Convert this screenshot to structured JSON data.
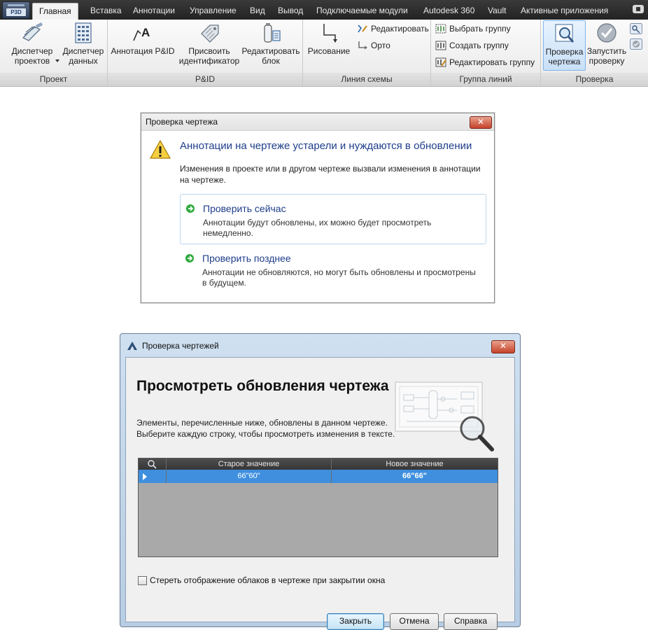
{
  "ribbon": {
    "app_badge": "P3D",
    "tabs": [
      {
        "label": "Главная",
        "active": true
      },
      {
        "label": "Вставка"
      },
      {
        "label": "Аннотации"
      },
      {
        "label": "Управление"
      },
      {
        "label": "Вид"
      },
      {
        "label": "Вывод"
      },
      {
        "label": "Подключаемые модули"
      },
      {
        "label": "Autodesk 360"
      },
      {
        "label": "Vault"
      },
      {
        "label": "Активные приложения"
      }
    ],
    "groups": {
      "project": {
        "label": "Проект",
        "project_manager": "Диспетчер\nпроектов",
        "data_manager": "Диспетчер\nданных"
      },
      "pid": {
        "label": "P&ID",
        "annotation": "Аннотация P&ID",
        "assign_tag": "Присвоить\nидентификатор",
        "edit_block": "Редактировать\nблок"
      },
      "schematic_line": {
        "label": "Линия схемы",
        "draw": "Рисование",
        "edit": "Редактировать",
        "ortho": "Орто"
      },
      "line_group": {
        "label": "Группа линий",
        "select": "Выбрать группу",
        "create": "Создать группу",
        "edit": "Редактировать группу"
      },
      "validate": {
        "label": "Проверка",
        "check_drawing": "Проверка\nчертежа",
        "run_check": "Запустить\nпроверку"
      }
    }
  },
  "dialog1": {
    "title": "Проверка чертежа",
    "close": "✕",
    "heading": "Аннотации на чертеже устарели и нуждаются в обновлении",
    "description": "Изменения в проекте или в другом чертеже вызвали изменения в аннотации на чертеже.",
    "options": [
      {
        "title": "Проверить сейчас",
        "description": "Аннотации будут обновлены, их можно будет просмотреть немедленно."
      },
      {
        "title": "Проверить позднее",
        "description": "Аннотации не обновляются, но могут быть обновлены и просмотрены в будущем."
      }
    ]
  },
  "dialog2": {
    "title": "Проверка чертежей",
    "close": "✕",
    "heading": "Просмотреть обновления чертежа",
    "description_line1": "Элементы, перечисленные ниже, обновлены в данном чертеже.",
    "description_line2": "Выберите каждую строку, чтобы просмотреть изменения в тексте.",
    "table": {
      "columns": [
        "",
        "Старое значение",
        "Новое значение"
      ],
      "rows": [
        {
          "old_value": "66\"60\"",
          "new_value": "66\"66\""
        }
      ]
    },
    "checkbox_label": "Стереть отображение облаков в чертеже при закрытии окна",
    "checkbox_checked": false,
    "buttons": {
      "close": "Закрыть",
      "cancel": "Отмена",
      "help": "Справка"
    }
  }
}
